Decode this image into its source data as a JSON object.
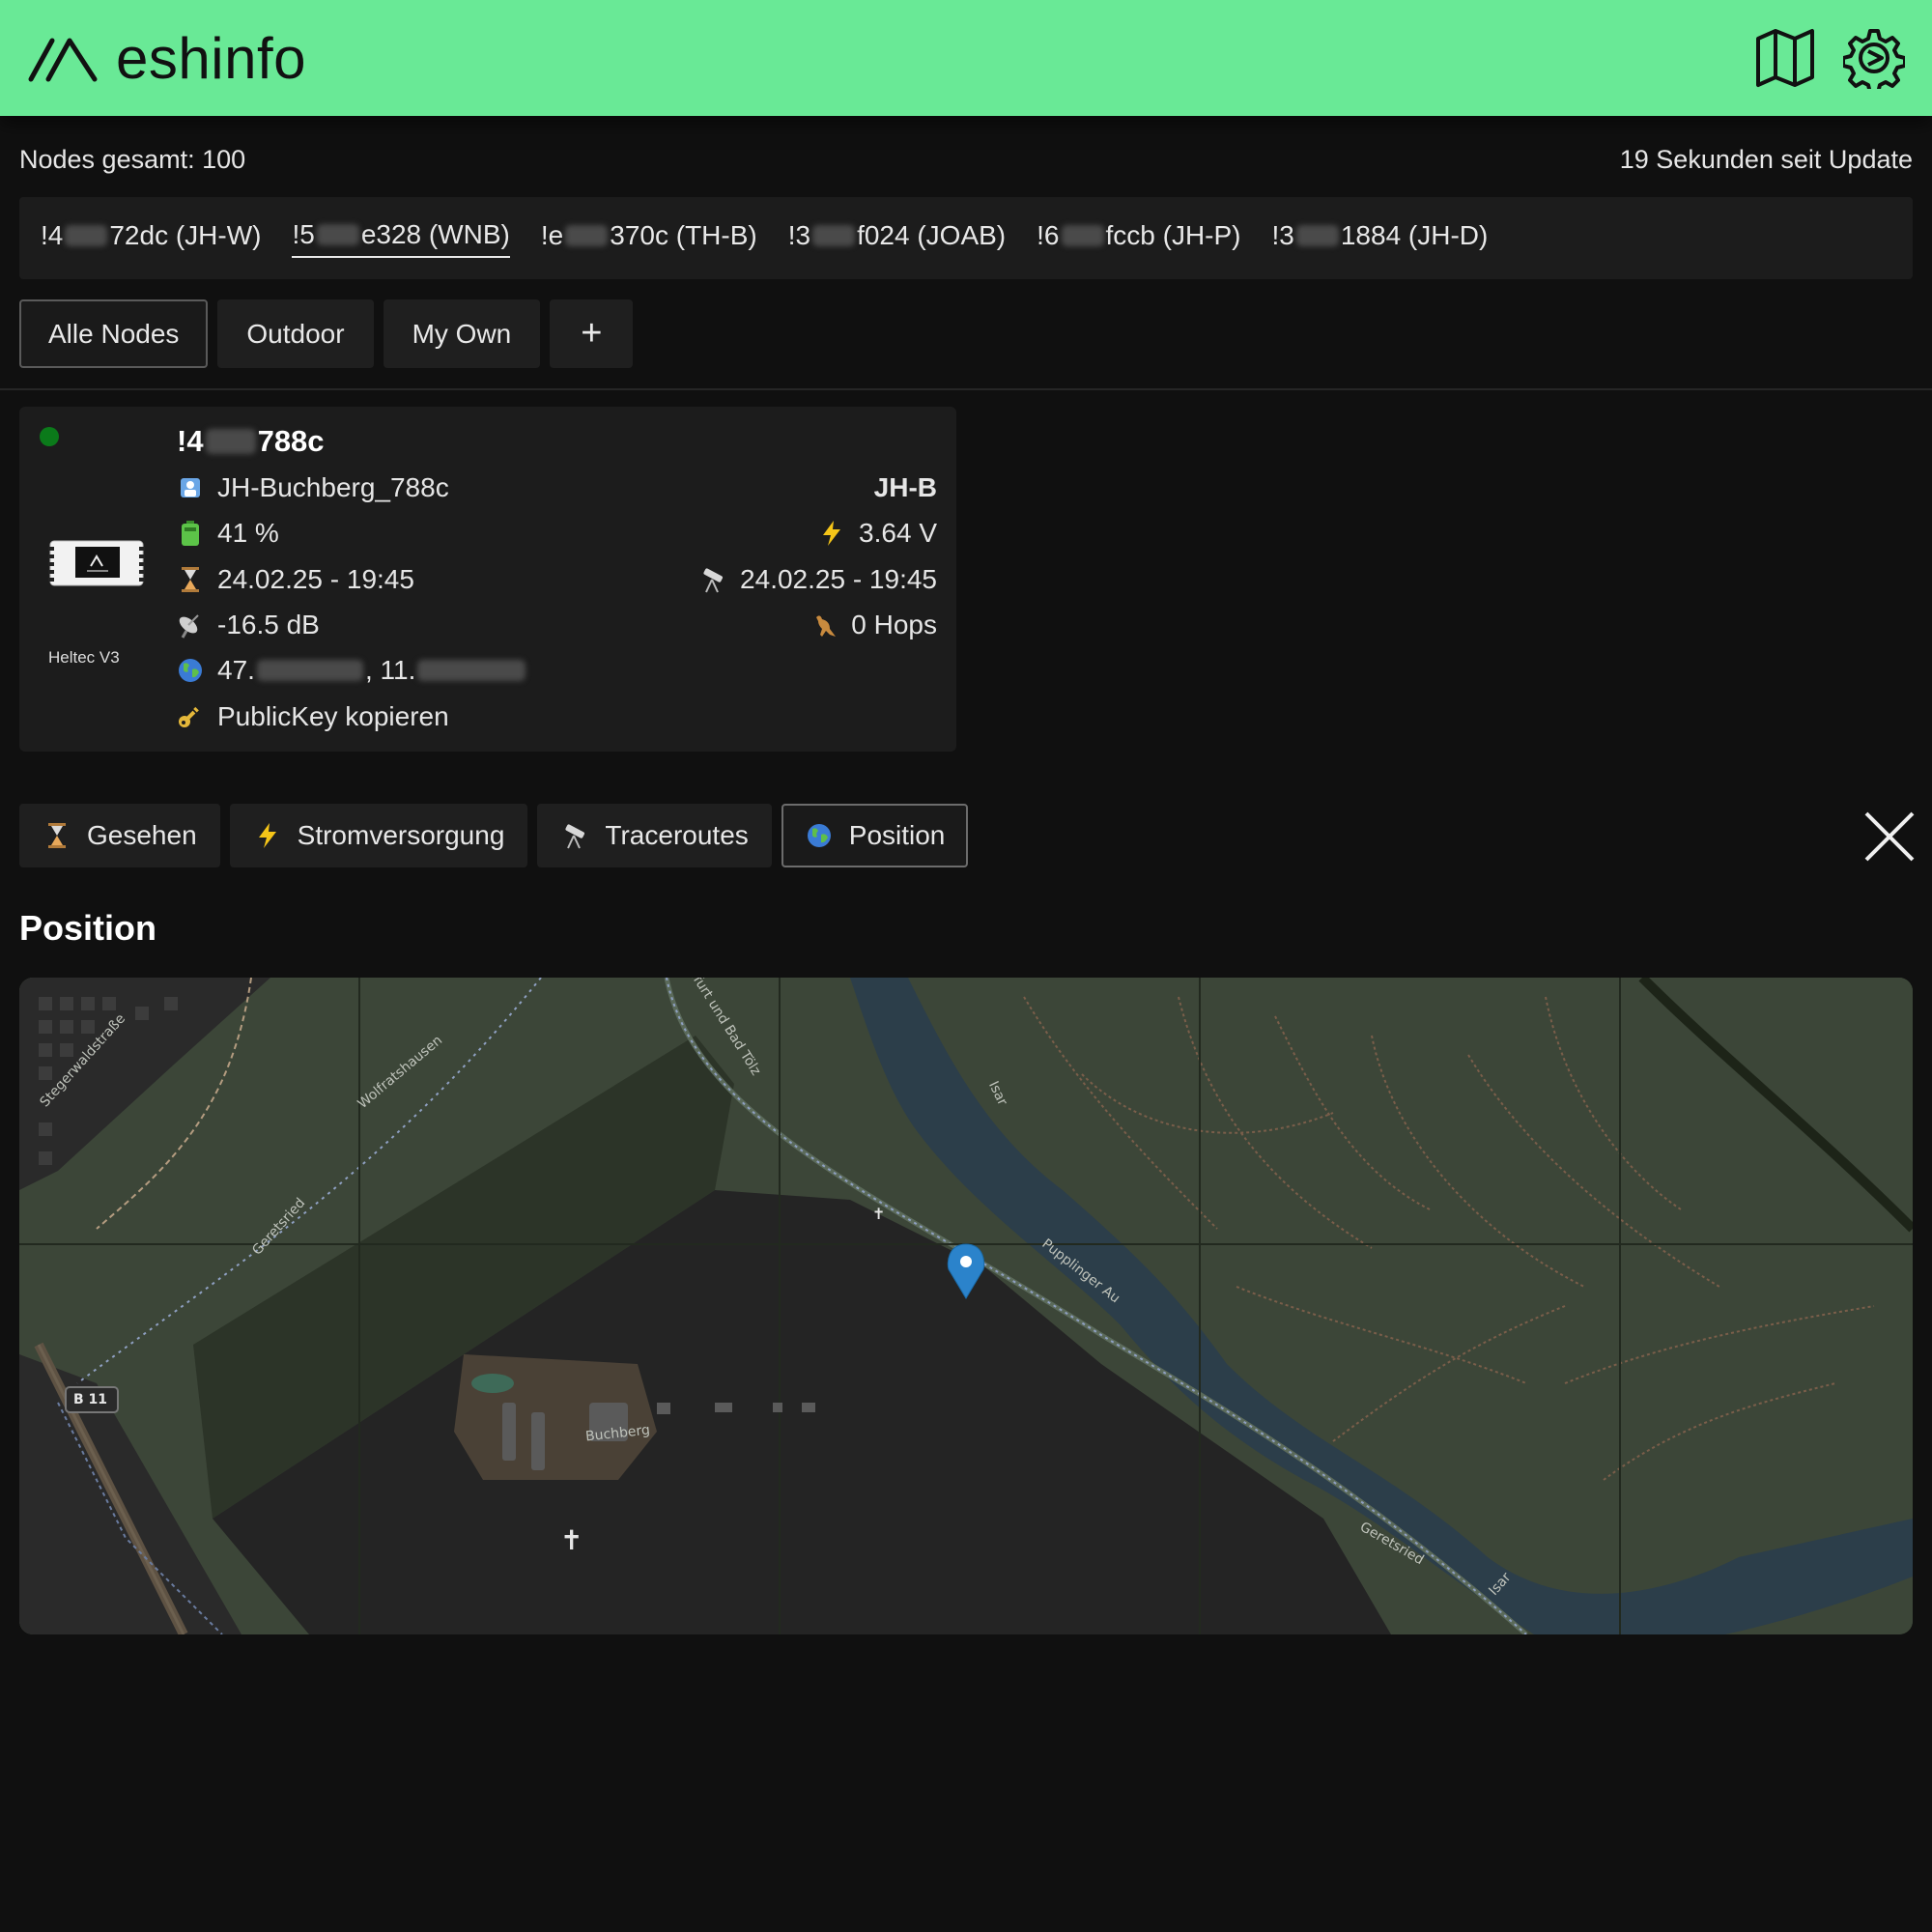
{
  "app": {
    "title": "eshinfo",
    "brand_color": "#69e996"
  },
  "header": {
    "icons": [
      "map-icon",
      "settings-icon"
    ]
  },
  "status": {
    "total_nodes": "Nodes gesamt: 100",
    "last_update": "19 Sekunden seit Update"
  },
  "favorites": [
    {
      "prefix": "!4",
      "suffix": "72dc (JH-W)",
      "active": false
    },
    {
      "prefix": "!5",
      "suffix": "e328 (WNB)",
      "active": true
    },
    {
      "prefix": "!e",
      "suffix": "370c (TH-B)",
      "active": false
    },
    {
      "prefix": "!3",
      "suffix": "f024 (JOAB)",
      "active": false
    },
    {
      "prefix": "!6",
      "suffix": "fccb (JH-P)",
      "active": false
    },
    {
      "prefix": "!3",
      "suffix": "1884 (JH-D)",
      "active": false
    }
  ],
  "filters": {
    "all": "Alle Nodes",
    "outdoor": "Outdoor",
    "own": "My Own",
    "add": "+"
  },
  "node": {
    "id_prefix": "!4",
    "id_suffix": "788c",
    "long_name": "JH-Buchberg_788c",
    "short_name": "JH-B",
    "battery": "41 %",
    "voltage": "3.64 V",
    "last_heard": "24.02.25 - 19:45",
    "last_seen_trace": "24.02.25 - 19:45",
    "snr": "-16.5 dB",
    "hops": "0 Hops",
    "lat_prefix": "47.",
    "lon_prefix": ", 11.",
    "pubkey": "PublicKey kopieren",
    "hardware": "Heltec V3",
    "online_color": "#0b7a1a"
  },
  "tabs": {
    "seen": "Gesehen",
    "power": "Stromversorgung",
    "traceroutes": "Traceroutes",
    "position": "Position"
  },
  "section": {
    "title": "Position"
  },
  "map": {
    "labels": {
      "street1": "Stegerwaldstraße",
      "street2": "Wolfratshausen",
      "street3": "Geretsried",
      "street4": "Isar",
      "street5": "Pupplinger Au",
      "street6": "Buchberg",
      "street7": "Geretsried",
      "street8": "Isar",
      "street9": "lfurt und Bad Tölz",
      "road": "B 11"
    }
  }
}
